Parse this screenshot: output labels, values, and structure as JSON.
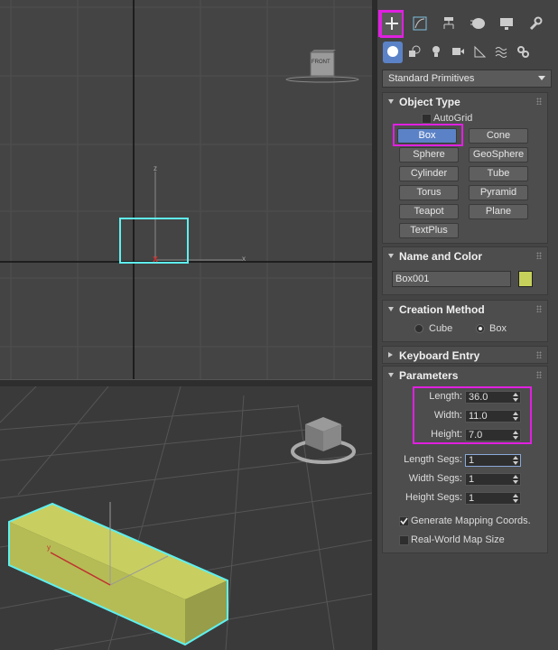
{
  "command_panel": {
    "tabs": [
      {
        "name": "create",
        "icon": "plus-icon",
        "active": true
      },
      {
        "name": "modify",
        "icon": "modify-curve-icon"
      },
      {
        "name": "hierarchy",
        "icon": "hierarchy-icon"
      },
      {
        "name": "motion",
        "icon": "motion-icon"
      },
      {
        "name": "display",
        "icon": "display-monitor-icon"
      },
      {
        "name": "utilities",
        "icon": "wrench-icon"
      }
    ],
    "subtabs": [
      {
        "name": "geometry",
        "icon": "sphere-icon",
        "active": true
      },
      {
        "name": "shapes",
        "icon": "shapes-icon"
      },
      {
        "name": "lights",
        "icon": "light-bulb-icon"
      },
      {
        "name": "cameras",
        "icon": "camera-icon"
      },
      {
        "name": "helpers",
        "icon": "tape-measure-icon"
      },
      {
        "name": "space-warps",
        "icon": "wave-icon"
      },
      {
        "name": "systems",
        "icon": "gears-icon"
      }
    ],
    "category_dropdown": "Standard Primitives"
  },
  "object_type": {
    "title": "Object Type",
    "autogrid_label": "AutoGrid",
    "autogrid_checked": false,
    "buttons": [
      "Box",
      "Cone",
      "Sphere",
      "GeoSphere",
      "Cylinder",
      "Tube",
      "Torus",
      "Pyramid",
      "Teapot",
      "Plane",
      "TextPlus"
    ],
    "selected": "Box"
  },
  "name_and_color": {
    "title": "Name and Color",
    "name_value": "Box001",
    "color": "#c5d15a"
  },
  "creation_method": {
    "title": "Creation Method",
    "options": [
      "Cube",
      "Box"
    ],
    "selected": "Box"
  },
  "keyboard_entry": {
    "title": "Keyboard Entry"
  },
  "parameters": {
    "title": "Parameters",
    "length_label": "Length:",
    "length_value": "36.0",
    "width_label": "Width:",
    "width_value": "11.0",
    "height_label": "Height:",
    "height_value": "7.0",
    "length_segs_label": "Length Segs:",
    "length_segs_value": "1",
    "width_segs_label": "Width Segs:",
    "width_segs_value": "1",
    "height_segs_label": "Height Segs:",
    "height_segs_value": "1",
    "gen_mapping_label": "Generate Mapping Coords.",
    "gen_mapping_checked": true,
    "real_world_label": "Real-World Map Size",
    "real_world_checked": false
  },
  "viewports": {
    "front": {
      "cube_label": "FRONT",
      "axis_x": "x",
      "axis_z": "z"
    },
    "perspective": {
      "axis_y": "y"
    }
  },
  "colors": {
    "highlight": "#e020e0",
    "selection_outline": "#5ff0f0",
    "active_blue": "#5b82c6",
    "box_color": "#c5d15a"
  }
}
